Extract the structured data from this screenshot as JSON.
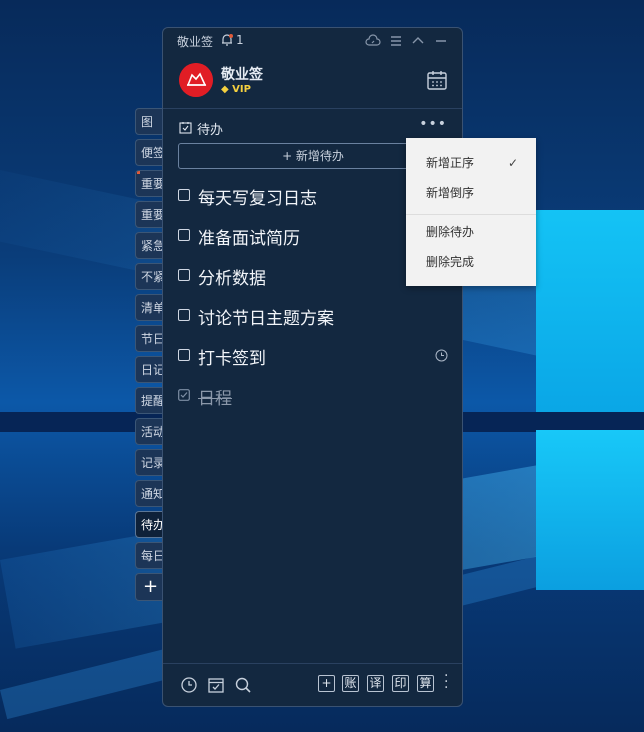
{
  "app": {
    "name": "敬业签",
    "notification_count": "1"
  },
  "user": {
    "name": "敬业签",
    "badge": "VIP"
  },
  "side_tabs": [
    {
      "label": "图"
    },
    {
      "label": "便签"
    },
    {
      "label": "重要"
    },
    {
      "label": "重要"
    },
    {
      "label": "紧急"
    },
    {
      "label": "不紧"
    },
    {
      "label": "清单"
    },
    {
      "label": "节日"
    },
    {
      "label": "日记"
    },
    {
      "label": "提醒"
    },
    {
      "label": "活动"
    },
    {
      "label": "记录"
    },
    {
      "label": "通知"
    },
    {
      "label": "待办"
    },
    {
      "label": "每日"
    }
  ],
  "side_add_label": "+",
  "section": {
    "title": "待办",
    "add_button": "+ 新增待办"
  },
  "todos": [
    {
      "text": "每天写复习日志",
      "done": false
    },
    {
      "text": "准备面试简历",
      "done": false
    },
    {
      "text": "分析数据",
      "done": false
    },
    {
      "text": "讨论节日主题方案",
      "done": false
    },
    {
      "text": "打卡签到",
      "done": false,
      "has_reminder": true
    },
    {
      "text": "日程",
      "done": true
    }
  ],
  "menu": {
    "items": [
      {
        "label": "新增正序",
        "checked": true
      },
      {
        "label": "新增倒序",
        "checked": false
      },
      {
        "label": "删除待办",
        "checked": false
      },
      {
        "label": "删除完成",
        "checked": false
      }
    ],
    "check_glyph": "✓"
  },
  "footer": {
    "buttons": [
      "+",
      "账",
      "译",
      "印",
      "算"
    ]
  },
  "colors": {
    "accent_red": "#e11d25",
    "panel_bg": "#132840",
    "vip_gold": "#f4d03f"
  }
}
